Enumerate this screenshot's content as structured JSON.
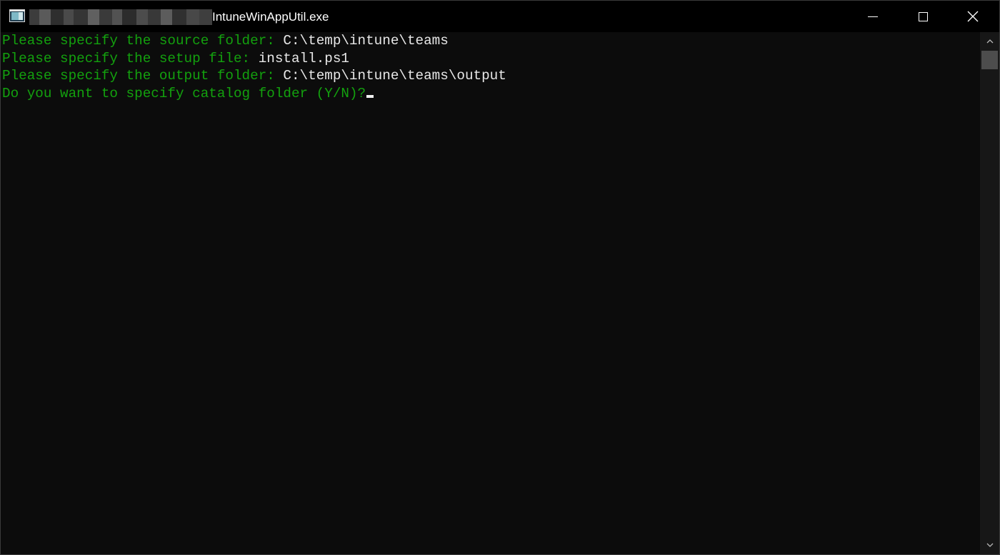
{
  "window": {
    "title": "IntuneWinAppUtil.exe",
    "controls": {
      "minimize": "minimize",
      "maximize": "maximize",
      "close": "close"
    }
  },
  "console": {
    "lines": [
      {
        "prompt": "Please specify the source folder: ",
        "value": "C:\\temp\\intune\\teams"
      },
      {
        "prompt": "Please specify the setup file: ",
        "value": "install.ps1"
      },
      {
        "prompt": "Please specify the output folder: ",
        "value": "C:\\temp\\intune\\teams\\output"
      },
      {
        "prompt": "Do you want to specify catalog folder (Y/N)?",
        "value": ""
      }
    ]
  },
  "colors": {
    "background": "#0c0c0c",
    "titlebar": "#000000",
    "prompt_text": "#13a10e",
    "input_text": "#e8e8e8"
  },
  "icons": {
    "app": "console-window-icon",
    "minimize": "minimize-icon",
    "maximize": "maximize-icon",
    "close": "close-icon",
    "scroll_up": "chevron-up-icon",
    "scroll_down": "chevron-down-icon"
  }
}
